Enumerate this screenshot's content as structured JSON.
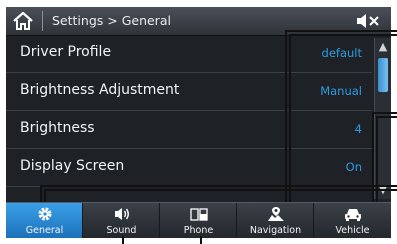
{
  "header": {
    "breadcrumb": "Settings > General"
  },
  "settings": [
    {
      "label": "Driver Profile",
      "value": "default"
    },
    {
      "label": "Brightness Adjustment",
      "value": "Manual"
    },
    {
      "label": "Brightness",
      "value": "4"
    },
    {
      "label": "Display Screen",
      "value": "On"
    }
  ],
  "scrollbar": {
    "position": 0.0
  },
  "nav": {
    "tabs": [
      {
        "label": "General",
        "icon": "gear-icon",
        "active": true
      },
      {
        "label": "Sound",
        "icon": "speaker-icon",
        "active": false
      },
      {
        "label": "Phone",
        "icon": "phone-icon",
        "active": false
      },
      {
        "label": "Navigation",
        "icon": "navigation-icon",
        "active": false
      },
      {
        "label": "Vehicle",
        "icon": "car-icon",
        "active": false
      }
    ]
  },
  "colors": {
    "accent": "#2d9be0",
    "active_tab": "#2a88d4",
    "background": "#1e2227"
  }
}
